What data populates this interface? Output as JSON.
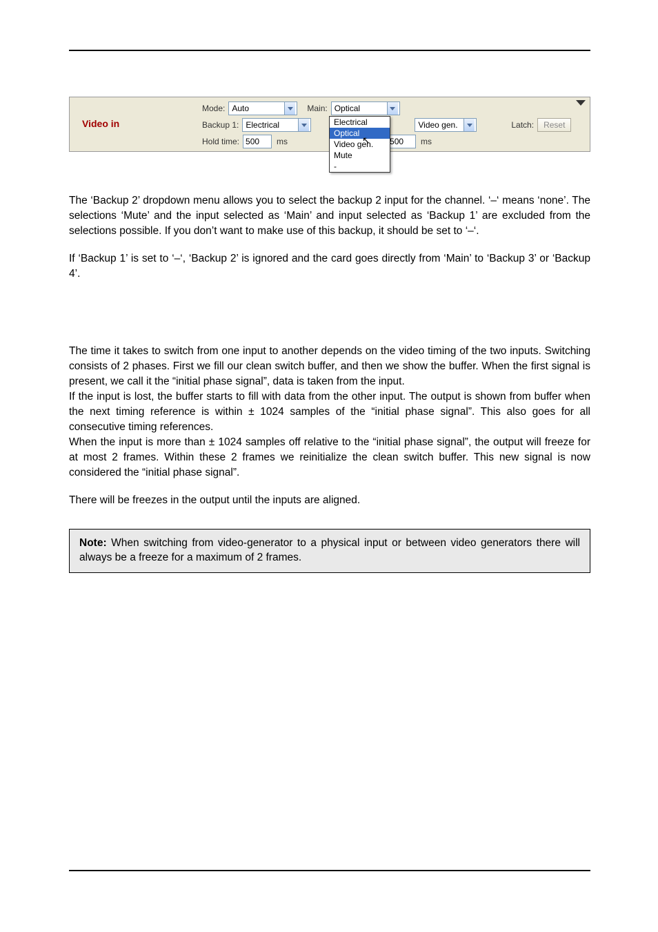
{
  "screenshot": {
    "label": "Video in",
    "mode_label": "Mode:",
    "mode_value": "Auto",
    "main_label": "Main:",
    "main_value": "Optical",
    "backup1_label": "Backup 1:",
    "backup1_value": "Electrical",
    "backup2_value": "Video gen.",
    "latch_label": "Latch:",
    "reset_label": "Reset",
    "holdtime_label": "Hold time:",
    "holdtime_value": "500",
    "holdtime2_value": "500",
    "ms_label": "ms",
    "dropdown_opts": [
      "Electrical",
      "Optical",
      "Video gen.",
      "Mute",
      "-"
    ]
  },
  "para1": "The ‘Backup 2’ dropdown menu allows you to select the backup 2 input for the channel. ‘–‘ means ‘none’. The selections ‘Mute’ and the input selected as ‘Main’ and input selected as ‘Backup 1’ are excluded from the selections possible. If you don’t want to make use of this backup, it should be set to ‘–‘.",
  "para2": "If ‘Backup 1’ is set to ‘–‘, ‘Backup 2’ is ignored and the card goes directly from ‘Main’ to ‘Backup 3’ or ‘Backup 4’.",
  "para3a": "The time it takes to switch from one input to another depends on the video timing of the two inputs. Switching consists of 2 phases. First we fill our clean switch buffer, and then we show the buffer. When the first signal is present, we call it the “initial phase signal”, data is taken from the input.",
  "para3b": "If the input is lost, the buffer starts to fill with data from the other input. The output is shown from buffer when the next timing reference is within ± 1024 samples of the “initial phase signal”. This also goes for all consecutive timing references.",
  "para3c": "When the input is more than ± 1024 samples off relative to the “initial phase signal”, the output will freeze for at most 2 frames. Within these 2 frames we reinitialize the clean switch buffer. This new signal is now considered the “initial phase signal”.",
  "para4": "There will be freezes in the output until the inputs are aligned.",
  "note_label": "Note:",
  "note_text": " When switching from video-generator to a physical input or between video generators there will always be a freeze for a maximum of 2 frames."
}
